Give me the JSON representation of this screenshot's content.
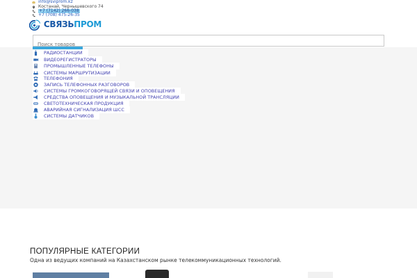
{
  "contacts": {
    "email": "info@sviprom.kz",
    "address": "Костанай, Чернышевского 74",
    "phone1": "+7 (7142) 266-038",
    "phone2": "+7 (708) 475-26-35"
  },
  "logo": {
    "text_main": "СВЯЗЬ",
    "text_accent": "ПРОМ"
  },
  "search": {
    "placeholder": "Поиск товаров"
  },
  "categories": [
    "РАДИОСТАНЦИИ",
    "ВИДЕОРЕГИСТРАТОРЫ",
    "ПРОМЫШЛЕННЫЕ ТЕЛЕФОНЫ",
    "СИСТЕМЫ МАРШРУТИЗАЦИИ",
    "ТЕЛЕФОНИЯ",
    "ЗАПИСЬ ТЕЛЕФОННЫХ РАЗГОВОРОВ",
    "СИСТЕМЫ ГРОМКОГОВОРЯЩЕЙ СВЯЗИ И ОПОВЕЩЕНИЯ",
    "СРЕДСТВА ОПОВЕЩЕНИЯ И МУЗЫКАЛЬНОЙ ТРАНСЛЯЦИИ",
    "СВЕТОТЕХНИЧЕСКАЯ ПРОДУКЦИЯ",
    "АВАРИЙНАЯ СИГНАЛИЗАЦИЯ ШСС",
    "СИСТЕМЫ ДАТЧИКОВ"
  ],
  "popular": {
    "title": "ПОПУЛЯРНЫЕ КАТЕГОРИИ",
    "subtitle": "Одна из ведущих компаний на Казахстанском рынке телекоммуникационных технологий."
  },
  "colors": {
    "brand_blue": "#1a5aa8",
    "brand_light": "#1c9ad6",
    "menu_text": "#3f3fb0",
    "hero_bg": "#f5f5f5"
  }
}
